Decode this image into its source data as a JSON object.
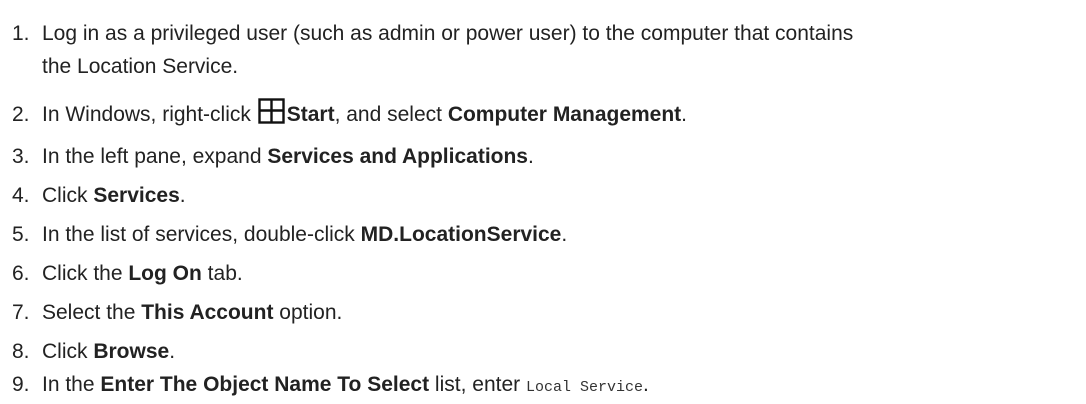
{
  "steps": [
    {
      "number": "1.",
      "line1": "Log in as a privileged user (such as admin or power user) to the computer that contains",
      "line2": "the Location Service."
    },
    {
      "number": "2.",
      "pre": "In Windows, right-click ",
      "icon": "windows-start-icon",
      "bold1": "Start",
      "mid": ", and select ",
      "bold2": "Computer Management",
      "post": "."
    },
    {
      "number": "3.",
      "pre": "In the left pane, expand ",
      "bold": "Services and Applications",
      "post": "."
    },
    {
      "number": "4.",
      "pre": "Click ",
      "bold": "Services",
      "post": "."
    },
    {
      "number": "5.",
      "pre": "In the list of services, double-click ",
      "bold": "MD.LocationService",
      "post": "."
    },
    {
      "number": "6.",
      "pre": "Click the ",
      "bold": "Log On",
      "post": " tab."
    },
    {
      "number": "7.",
      "pre": "Select the ",
      "bold": "This Account",
      "post": " option."
    },
    {
      "number": "8.",
      "pre": "Click ",
      "bold": "Browse",
      "post": "."
    },
    {
      "number": "9.",
      "pre": "In the ",
      "bold": "Enter The Object Name To Select",
      "mid": " list, enter ",
      "code": "Local Service",
      "post": "."
    }
  ]
}
